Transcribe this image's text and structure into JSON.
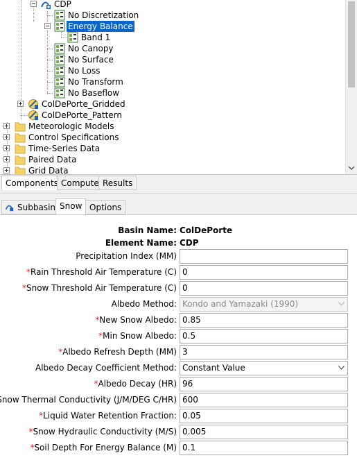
{
  "tree": {
    "items": [
      {
        "label": "CDP",
        "icon": "subbasin-icon"
      },
      {
        "label": "No Discretization",
        "icon": "method-icon"
      },
      {
        "label": "Energy Balance",
        "icon": "method-icon",
        "selected": true
      },
      {
        "label": "Band 1",
        "icon": "method-icon"
      },
      {
        "label": "No Canopy",
        "icon": "method-icon"
      },
      {
        "label": "No Surface",
        "icon": "method-icon"
      },
      {
        "label": "No Loss",
        "icon": "method-icon"
      },
      {
        "label": "No Transform",
        "icon": "method-icon"
      },
      {
        "label": "No Baseflow",
        "icon": "method-icon"
      },
      {
        "label": "ColDePorte_Gridded",
        "icon": "met-model-icon"
      },
      {
        "label": "ColDePorte_Pattern",
        "icon": "met-model-icon"
      },
      {
        "label": "Meteorologic Models",
        "icon": "folder-icon"
      },
      {
        "label": "Control Specifications",
        "icon": "folder-icon"
      },
      {
        "label": "Time-Series Data",
        "icon": "folder-icon"
      },
      {
        "label": "Paired Data",
        "icon": "folder-icon"
      },
      {
        "label": "Grid Data",
        "icon": "folder-icon"
      }
    ]
  },
  "lower_tabs": [
    "Components",
    "Compute",
    "Results"
  ],
  "editor_tabs": [
    "Subbasin",
    "Snow",
    "Options"
  ],
  "form": {
    "basin_name_label": "Basin Name:",
    "basin_name_value": "ColDePorte",
    "element_name_label": "Element Name:",
    "element_name_value": "CDP",
    "precip_index_label": "Precipitation Index (MM)",
    "precip_index_value": "",
    "rain_threshold_label": "Rain Threshold Air Temperature (C)",
    "rain_threshold_value": "0",
    "snow_threshold_label": "Snow Threshold Air Temperature (C)",
    "snow_threshold_value": "0",
    "albedo_method_label": "Albedo Method:",
    "albedo_method_value": "Kondo and Yamazaki (1990)",
    "new_snow_albedo_label": "New Snow Albedo:",
    "new_snow_albedo_value": "0.85",
    "min_snow_albedo_label": "Min Snow Albedo:",
    "min_snow_albedo_value": "0.5",
    "albedo_refresh_label": "Albedo Refresh Depth (MM)",
    "albedo_refresh_value": "3",
    "decay_method_label": "Albedo Decay Coefficient Method:",
    "decay_method_value": "Constant Value",
    "albedo_decay_label": "Albedo Decay (HR)",
    "albedo_decay_value": "96",
    "thermal_cond_label": "Snow Thermal Conductivity (J/M/DEG C/HR)",
    "thermal_cond_value": "600",
    "liquid_water_label": "Liquid Water Retention Fraction:",
    "liquid_water_value": "0.05",
    "hydraulic_cond_label": "Snow Hydraulic Conductivity (M/S)",
    "hydraulic_cond_value": "0.005",
    "soil_depth_label": "Soil Depth For Energy Balance (M)",
    "soil_depth_value": "0.1",
    "required_marker": "*"
  },
  "colors": {
    "selection": "#0a66cc",
    "required": "#dd2222",
    "folder": "#f5d36b"
  }
}
